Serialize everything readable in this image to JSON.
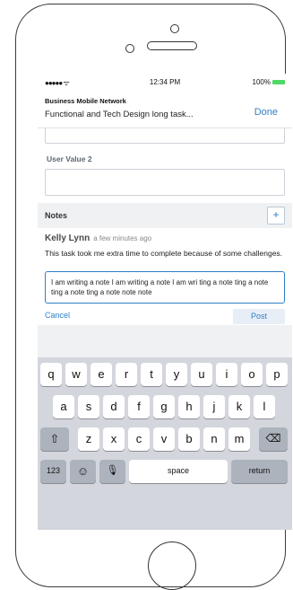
{
  "status": {
    "signal": "●●●●● ᯤ",
    "time": "12:34 PM",
    "battery": "100%"
  },
  "nav": {
    "title": "Business Mobile Network",
    "subtitle": "Functional and Tech Design long task...",
    "done": "Done"
  },
  "form": {
    "user_value_2_label": "User Value 2"
  },
  "notes": {
    "header": "Notes",
    "add": "+",
    "author": "Kelly Lynn",
    "time_ago": "a few minutes ago",
    "text": "This task took me extra time to complete because of some challenges."
  },
  "compose": {
    "value": "I am writing a note I am writing a note I am wri ting a note ting a note ting a note ting a note note note",
    "cancel": "Cancel",
    "post": "Post"
  },
  "keyboard": {
    "row1": [
      "q",
      "w",
      "e",
      "r",
      "t",
      "y",
      "u",
      "i",
      "o",
      "p"
    ],
    "row2": [
      "a",
      "s",
      "d",
      "f",
      "g",
      "h",
      "j",
      "k",
      "l"
    ],
    "row3": [
      "z",
      "x",
      "c",
      "v",
      "b",
      "n",
      "m"
    ],
    "shift": "⇧",
    "delete": "⌫",
    "numbers": "123",
    "emoji": "☺",
    "mic": "🎙",
    "space": "space",
    "return": "return"
  }
}
